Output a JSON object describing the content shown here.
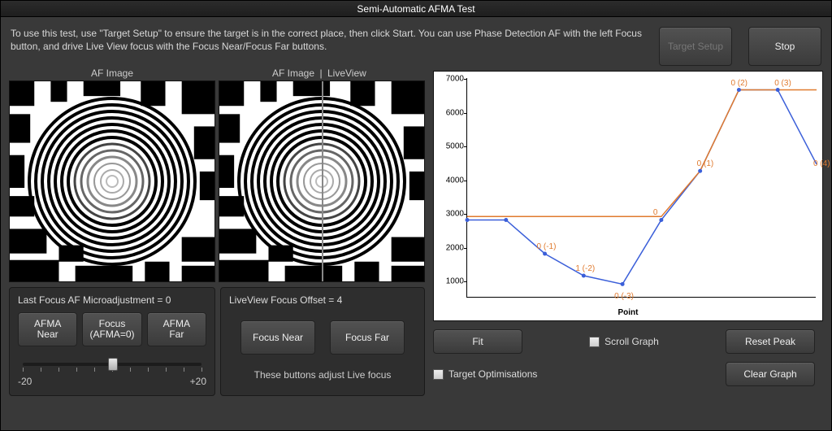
{
  "window": {
    "title": "Semi-Automatic AFMA Test"
  },
  "instructions": "To use this test, use \"Target Setup\" to ensure the target is in the correct place, then click Start.  You can use Phase Detection AF with the left Focus button, and drive Live View focus with the Focus Near/Focus Far buttons.",
  "header_buttons": {
    "target_setup": "Target Setup",
    "stop": "Stop"
  },
  "image_headers": {
    "left": "AF Image",
    "right_left_half": "AF Image",
    "right_right_half": "LiveView",
    "divider": "|"
  },
  "afma_panel": {
    "title": "Last Focus AF Microadjustment = 0",
    "buttons": {
      "near": "AFMA\nNear",
      "focus": "Focus\n(AFMA=0)",
      "far": "AFMA\nFar"
    },
    "slider": {
      "min_label": "-20",
      "max_label": "+20",
      "min": -20,
      "max": 20,
      "value": 0
    }
  },
  "liveview_panel": {
    "title": "LiveView Focus Offset = 4",
    "buttons": {
      "near": "Focus Near",
      "far": "Focus Far"
    },
    "note": "These buttons adjust Live focus"
  },
  "chart_controls": {
    "fit": "Fit",
    "scroll_graph": "Scroll Graph",
    "reset_peak": "Reset Peak",
    "target_opt": "Target Optimisations",
    "clear_graph": "Clear Graph"
  },
  "chart_data": {
    "type": "line",
    "xlabel": "Point",
    "ylabel": "",
    "ylim": [
      500,
      7000
    ],
    "yticks": [
      1000,
      2000,
      3000,
      4000,
      5000,
      6000,
      7000
    ],
    "x": [
      0,
      1,
      2,
      3,
      4,
      5,
      6,
      7,
      8
    ],
    "series": [
      {
        "name": "blue",
        "color": "#3b5fd9",
        "values": [
          2800,
          2800,
          1800,
          1150,
          900,
          2800,
          4250,
          6650,
          6650
        ]
      },
      {
        "name": "blue-tail",
        "color": "#3b5fd9",
        "x": [
          8,
          9
        ],
        "values": [
          6650,
          4450
        ]
      },
      {
        "name": "orange-step",
        "color": "#e07a2e",
        "x": [
          0,
          5,
          5,
          6,
          6,
          7,
          7,
          9
        ],
        "values": [
          2900,
          2900,
          2900,
          4250,
          4250,
          6650,
          6650,
          6650
        ]
      }
    ],
    "point_labels": [
      {
        "x": 2,
        "y": 1800,
        "text": "0 (-1)",
        "dy": -14
      },
      {
        "x": 3,
        "y": 1150,
        "text": "1 (-2)",
        "dy": -14
      },
      {
        "x": 4,
        "y": 900,
        "text": "0 (-3)",
        "dy": 10
      },
      {
        "x": 5,
        "y": 2800,
        "text": "0",
        "dy": -14
      },
      {
        "x": 6,
        "y": 4250,
        "text": "0 (1)",
        "dy": -14,
        "dx": 6
      },
      {
        "x": 7,
        "y": 6650,
        "text": "0 (2)",
        "dy": -14
      },
      {
        "x": 8,
        "y": 6650,
        "text": "0 (3)",
        "dy": -14,
        "dx": 6
      },
      {
        "x": 9,
        "y": 4450,
        "text": "0 (4)",
        "dy": -6,
        "dx": 6
      }
    ]
  }
}
